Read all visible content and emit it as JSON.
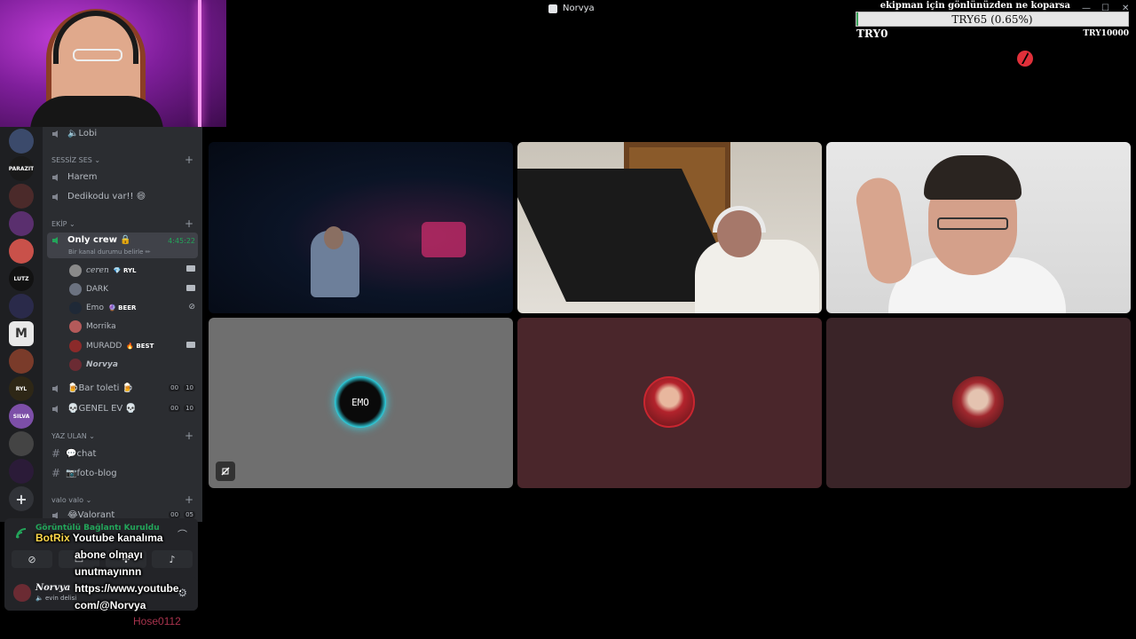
{
  "window": {
    "title": "Norvya",
    "controls": [
      "—",
      "☐",
      "✕"
    ]
  },
  "donation_goal": {
    "text": "ekipman için gönlünüzden ne koparsa",
    "bar_label": "TRY65 (0.65%)",
    "progress_percent": 0.65,
    "min_label": "TRY0",
    "max_label": "TRY10000",
    "fill_color": "#3ca55c"
  },
  "servers": [
    {
      "name": "server-1",
      "icon": "",
      "color": "#3b4a6b"
    },
    {
      "name": "parazit",
      "icon": "PARAZIT",
      "color": "#1a1a1a"
    },
    {
      "name": "server-3",
      "icon": "",
      "color": "#4b2a2a"
    },
    {
      "name": "server-4",
      "icon": "",
      "color": "#5a2f6e"
    },
    {
      "name": "server-5",
      "icon": "",
      "color": "#c9514a"
    },
    {
      "name": "lutz",
      "icon": "LUTZ",
      "color": "#121212"
    },
    {
      "name": "server-7",
      "icon": "",
      "color": "#2a2a4a"
    },
    {
      "name": "server-m",
      "icon": "M",
      "color": "#e8e8e8"
    },
    {
      "name": "server-9",
      "icon": "",
      "color": "#7a3b2a"
    },
    {
      "name": "ryl",
      "icon": "RYL",
      "color": "#2e2716"
    },
    {
      "name": "silva",
      "icon": "SILVA",
      "color": "#7d4fa8"
    },
    {
      "name": "server-12",
      "icon": "",
      "color": "#444"
    },
    {
      "name": "server-13",
      "icon": "",
      "color": "#2b1b38"
    },
    {
      "name": "add-server",
      "icon": "+",
      "color": "#313338"
    }
  ],
  "channels": {
    "top_channel": "🔈Lobi",
    "cat_sessiz": "SESSİZ SES",
    "harem": "Harem",
    "dedikodu": "Dedikodu var!! 😄",
    "cat_ekip": "EKİP",
    "only_crew": "Only crew 🔒",
    "only_crew_timer": "4:45:22",
    "only_crew_status": "Bir kanal durumu belirle ✏",
    "users": [
      {
        "name": "ceren",
        "tag": "💎 RYL",
        "color": "#8a8a8a"
      },
      {
        "name": "DARK",
        "tag": "",
        "color": "#6b7280"
      },
      {
        "name": "Emo",
        "tag": "🔮 BEER",
        "color": "#1f2937"
      },
      {
        "name": "Morrika",
        "tag": "",
        "color": "#b45a5a"
      },
      {
        "name": "MURADD",
        "tag": "🔥 BEST",
        "color": "#8b2a2a"
      },
      {
        "name": "𝙉𝙤𝙧𝙫𝙮𝙖",
        "tag": "",
        "color": "#6b2b33"
      }
    ],
    "bar_toleti": "🍺Bar toleti 🍺",
    "bar_toleti_counts": [
      "00",
      "10"
    ],
    "genel_ev": "💀GENEL EV 💀",
    "genel_ev_counts": [
      "00",
      "10"
    ],
    "cat_yaz": "YAZ ULAN",
    "chat": "💬chat",
    "foto_blog": "📷foto-blog",
    "cat_valo": "valo valo",
    "valorant": "😂Valorant",
    "valorant_counts": [
      "00",
      "05"
    ]
  },
  "voice_panel": {
    "connection_text": "Görüntülü Bağlantı Kuruldu",
    "buttons": [
      "camera-off",
      "screen-share",
      "activity",
      "soundboard"
    ]
  },
  "user_panel": {
    "name": "Norvya",
    "status": "🔈 evin delisi"
  },
  "botrix_overlay": {
    "name": "BotRix",
    "message_1": "Youtube kanalıma",
    "message_2": "abone olmayı",
    "message_3": "unutmayınnn",
    "message_4": "https://www.youtube.",
    "message_5": "com/@Norvya"
  },
  "footer_name": "Hose0112",
  "tiles": [
    {
      "name": "tile-dark-room",
      "kind": "video",
      "bg": "#07101f"
    },
    {
      "name": "tile-headset-monitor",
      "kind": "video",
      "bg": "#d9d6d0"
    },
    {
      "name": "tile-glasses-guy",
      "kind": "video",
      "bg": "#e9e9e9"
    },
    {
      "name": "tile-emo",
      "kind": "avatar",
      "bg": "#6f6f6f",
      "avatar_label": "EMO"
    },
    {
      "name": "tile-red-hair-1",
      "kind": "avatar",
      "bg": "#4a262b"
    },
    {
      "name": "tile-red-hair-2",
      "kind": "avatar",
      "bg": "#3a2428"
    }
  ]
}
